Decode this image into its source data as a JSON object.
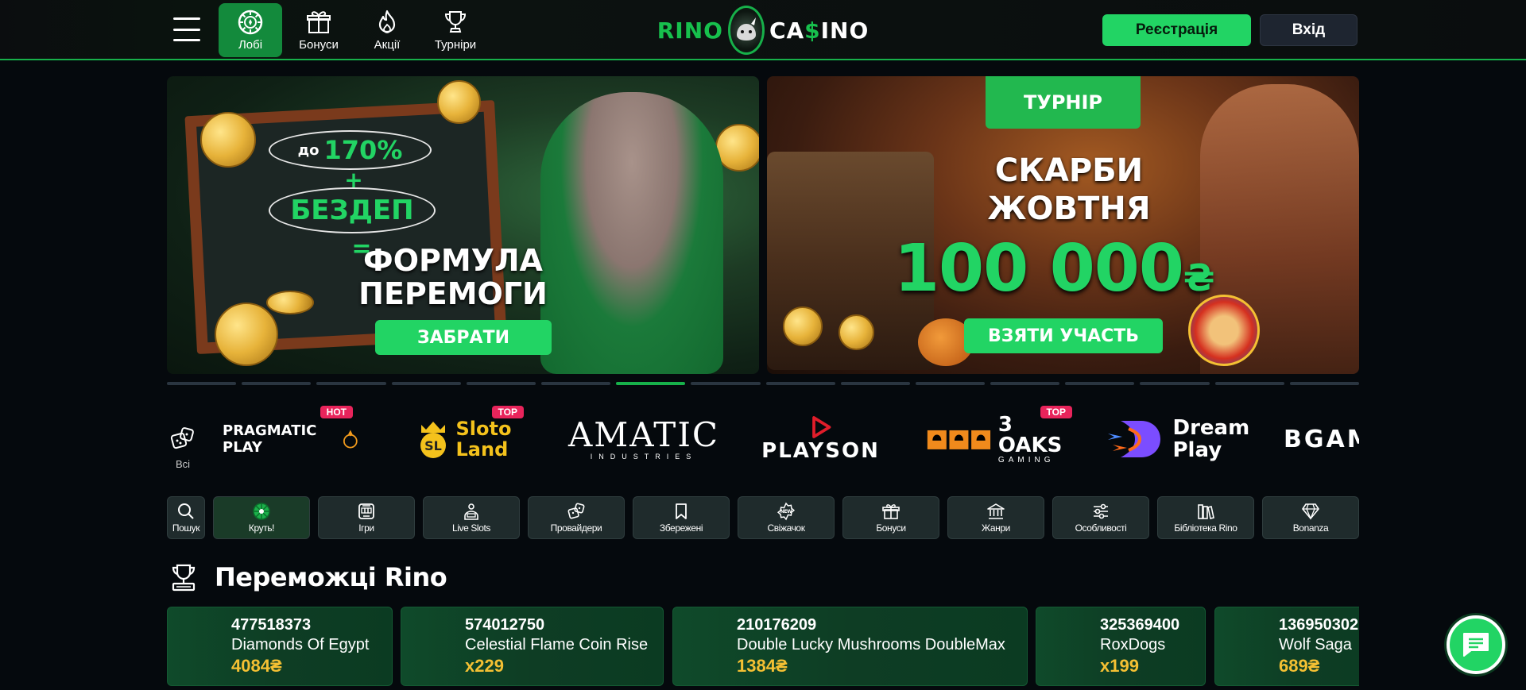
{
  "header": {
    "nav": [
      {
        "label": "Лобі",
        "icon": "poker-chip-icon",
        "active": true
      },
      {
        "label": "Бонуси",
        "icon": "gift-icon",
        "active": false
      },
      {
        "label": "Акції",
        "icon": "flame-icon",
        "active": false
      },
      {
        "label": "Турніри",
        "icon": "trophy-icon",
        "active": false
      }
    ],
    "logo": {
      "left": "RINO",
      "right_a": "CA",
      "right_dollar": "$",
      "right_b": "INO"
    },
    "register_label": "Реєстрація",
    "login_label": "Вхід"
  },
  "banners": {
    "b1": {
      "upto": "до",
      "percent": "170%",
      "plus": "+",
      "bezdep": "БЕЗДЕП",
      "equals": "=",
      "line1": "ФОРМУЛА",
      "line2": "ПЕРЕМОГИ",
      "cta": "ЗАБРАТИ"
    },
    "b2": {
      "tag": "ТУРНІР",
      "title1": "СКАРБИ",
      "title2": "ЖОВТНЯ",
      "prize": "100 000",
      "currency": "₴",
      "cta": "ВЗЯТИ УЧАСТЬ"
    }
  },
  "carousel": {
    "count": 16,
    "active_index": 6
  },
  "providers": {
    "all_label": "Всі",
    "items": [
      {
        "name": "PRAGMATIC PLAY",
        "badge": "HOT"
      },
      {
        "name": "Sloto Land",
        "badge": "TOP"
      },
      {
        "name": "AMATIC",
        "sub": "INDUSTRIES",
        "badge": ""
      },
      {
        "name": "PLAYSON",
        "badge": ""
      },
      {
        "name": "3 OAKS",
        "sub": "GAMING",
        "badge": "TOP"
      },
      {
        "name": "Dream Play",
        "badge": ""
      },
      {
        "name": "BGAM",
        "badge": ""
      }
    ]
  },
  "categories": [
    {
      "label": "Пошук",
      "icon": "search-icon"
    },
    {
      "label": "Круть!",
      "icon": "wheel-icon"
    },
    {
      "label": "Ігри",
      "icon": "slot-machine-icon"
    },
    {
      "label": "Live Slots",
      "icon": "live-slots-icon"
    },
    {
      "label": "Провайдери",
      "icon": "dice-icon"
    },
    {
      "label": "Збережені",
      "icon": "bookmark-icon"
    },
    {
      "label": "Свіжачок",
      "icon": "new-icon"
    },
    {
      "label": "Бонуси",
      "icon": "gift-icon"
    },
    {
      "label": "Жанри",
      "icon": "bank-icon"
    },
    {
      "label": "Особливості",
      "icon": "sliders-icon"
    },
    {
      "label": "Бібліотека Rino",
      "icon": "library-icon"
    },
    {
      "label": "Bonanza",
      "icon": "diamond-icon"
    }
  ],
  "winners": {
    "title": "Переможці Rino",
    "items": [
      {
        "id": "477518373",
        "game": "Diamonds Of Egypt",
        "amount": "4084₴"
      },
      {
        "id": "574012750",
        "game": "Celestial Flame Coin Rise",
        "amount": "x229"
      },
      {
        "id": "210176209",
        "game": "Double Lucky Mushrooms DoubleMax",
        "amount": "1384₴"
      },
      {
        "id": "325369400",
        "game": "RoxDogs",
        "amount": "x199"
      },
      {
        "id": "136950302",
        "game": "Wolf Saga",
        "amount": "689₴"
      }
    ]
  },
  "colors": {
    "accent": "#22d464",
    "accent_dark": "#17b04a",
    "gold": "#f4c033",
    "bg": "#05090d"
  }
}
